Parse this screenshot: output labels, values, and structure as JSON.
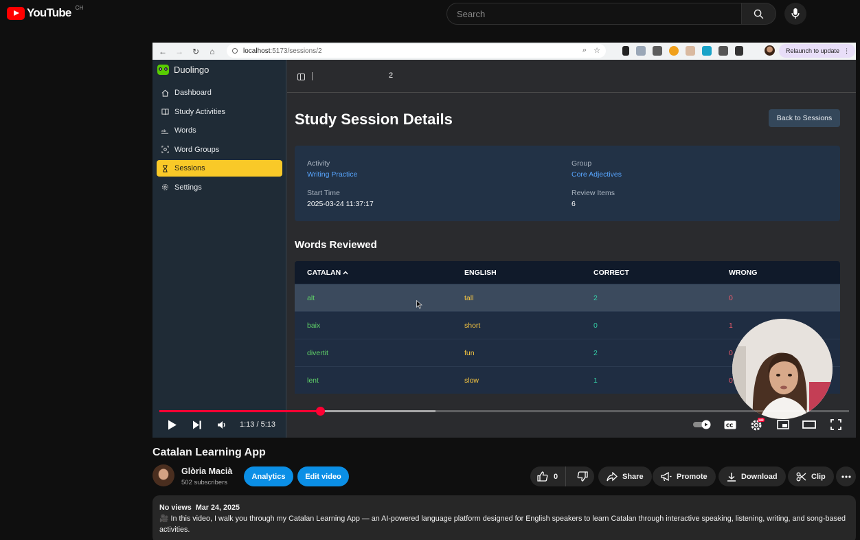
{
  "youtube": {
    "logo_text": "YouTube",
    "country": "CH",
    "search_placeholder": "Search"
  },
  "browser": {
    "url_host": "localhost",
    "url_path": ":5173/sessions/2",
    "relaunch_label": "Relaunch to update"
  },
  "app": {
    "brand": "Duolingo",
    "nav": [
      {
        "label": "Dashboard",
        "icon": "home-icon",
        "active": false
      },
      {
        "label": "Study Activities",
        "icon": "book-icon",
        "active": false
      },
      {
        "label": "Words",
        "icon": "abc-icon",
        "active": false
      },
      {
        "label": "Word Groups",
        "icon": "group-icon",
        "active": false
      },
      {
        "label": "Sessions",
        "icon": "hourglass-icon",
        "active": true
      },
      {
        "label": "Settings",
        "icon": "gear-icon",
        "active": false
      }
    ],
    "breadcrumb": "2",
    "page_title": "Study Session Details",
    "back_button": "Back to Sessions",
    "details": {
      "activity_label": "Activity",
      "activity_value": "Writing Practice",
      "group_label": "Group",
      "group_value": "Core Adjectives",
      "start_label": "Start Time",
      "start_value": "2025-03-24 11:37:17",
      "review_label": "Review Items",
      "review_value": "6"
    },
    "words_title": "Words Reviewed",
    "table": {
      "headers": [
        "CATALAN",
        "ENGLISH",
        "CORRECT",
        "WRONG"
      ],
      "sort_indicator": "^",
      "rows": [
        {
          "catalan": "alt",
          "english": "tall",
          "correct": "2",
          "wrong": "0"
        },
        {
          "catalan": "baix",
          "english": "short",
          "correct": "0",
          "wrong": "1"
        },
        {
          "catalan": "divertit",
          "english": "fun",
          "correct": "2",
          "wrong": "0"
        },
        {
          "catalan": "lent",
          "english": "slow",
          "correct": "1",
          "wrong": "0"
        }
      ]
    }
  },
  "player": {
    "time": "1:13 / 5:13",
    "progress": 0.233,
    "buffered": 0.4
  },
  "video": {
    "title": "Catalan Learning App",
    "channel": "Glòria Macià",
    "subscribers": "502 subscribers",
    "analytics": "Analytics",
    "edit_video": "Edit video",
    "likes": "0",
    "share": "Share",
    "promote": "Promote",
    "download": "Download",
    "clip": "Clip",
    "views": "No views",
    "date": "Mar 24, 2025",
    "description": "🎥 In this video, I walk you through my Catalan Learning App — an AI-powered language platform designed for English speakers to learn Catalan through interactive speaking, listening, writing, and song-based activities."
  }
}
